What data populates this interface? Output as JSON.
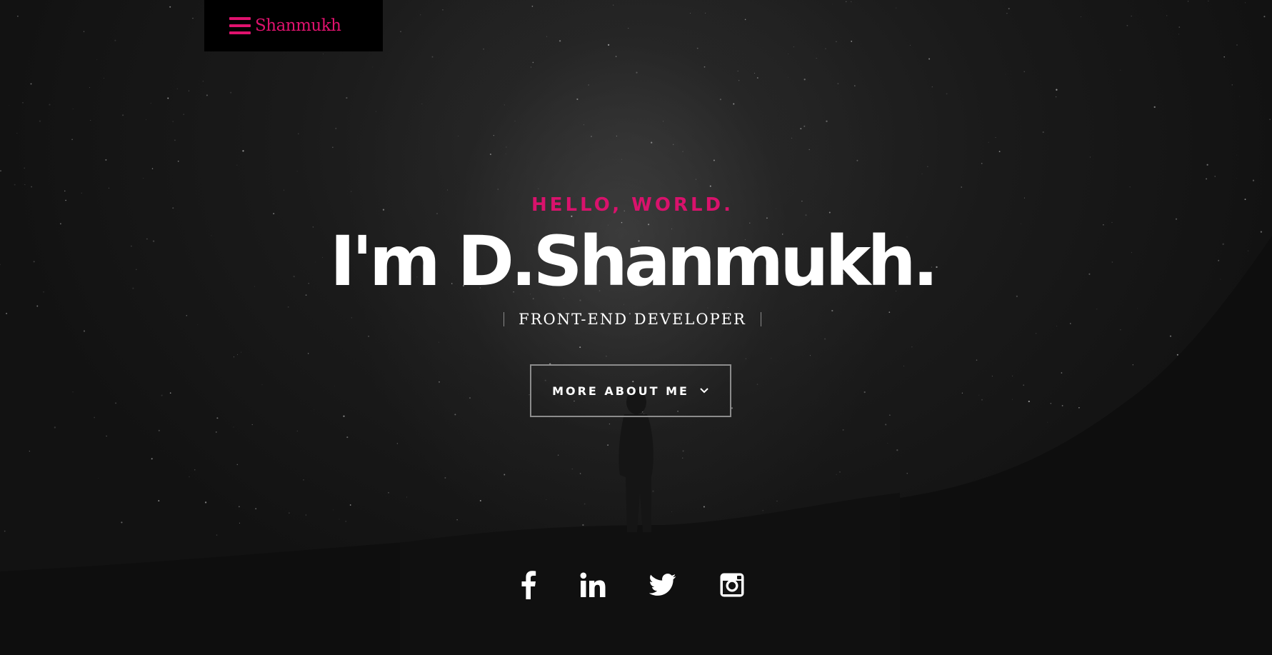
{
  "nav": {
    "brand": "Shanmukh",
    "menu_icon": "hamburger-menu-icon"
  },
  "hero": {
    "greeting": "HELLO, WORLD.",
    "headline": "I'm D.Shanmukh.",
    "role": "FRONT-END DEVELOPER",
    "cta_label": "MORE ABOUT ME",
    "cta_icon": "chevron-down-icon"
  },
  "social": [
    {
      "icon": "facebook-icon"
    },
    {
      "icon": "linkedin-icon"
    },
    {
      "icon": "twitter-icon"
    },
    {
      "icon": "instagram-icon"
    }
  ],
  "colors": {
    "accent": "#e0126e",
    "background": "#111111",
    "text": "#ffffff",
    "button_border": "#8c8c8c"
  }
}
